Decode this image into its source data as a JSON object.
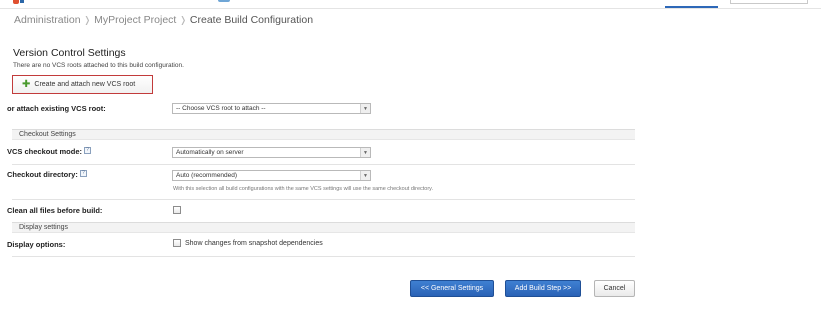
{
  "breadcrumb": {
    "items": [
      "Administration",
      "MyProject Project"
    ],
    "current": "Create Build Configuration"
  },
  "vcs": {
    "title": "Version Control Settings",
    "note": "There are no VCS roots attached to this build configuration.",
    "create_button": "Create and attach new VCS root",
    "attach_label": "or attach existing VCS root:",
    "attach_select": "-- Choose VCS root to attach --"
  },
  "checkout": {
    "group_title": "Checkout Settings",
    "mode_label": "VCS checkout mode:",
    "mode_value": "Automatically on server",
    "dir_label": "Checkout directory:",
    "dir_value": "Auto (recommended)",
    "dir_hint": "With this selection all build configurations with the same VCS settings will use the same checkout directory.",
    "clean_label": "Clean all files before build:",
    "clean_checked": false
  },
  "display": {
    "group_title": "Display settings",
    "options_label": "Display options:",
    "snapshot_label": "Show changes from snapshot dependencies",
    "snapshot_checked": false
  },
  "help_glyph": "?",
  "buttons": {
    "general": "<< General Settings",
    "add_step": "Add Build Step >>",
    "cancel": "Cancel"
  },
  "colors": {
    "primary_button": "#2d68b8",
    "highlight_border": "#c23b3b",
    "add_icon": "#4a9a2e"
  }
}
